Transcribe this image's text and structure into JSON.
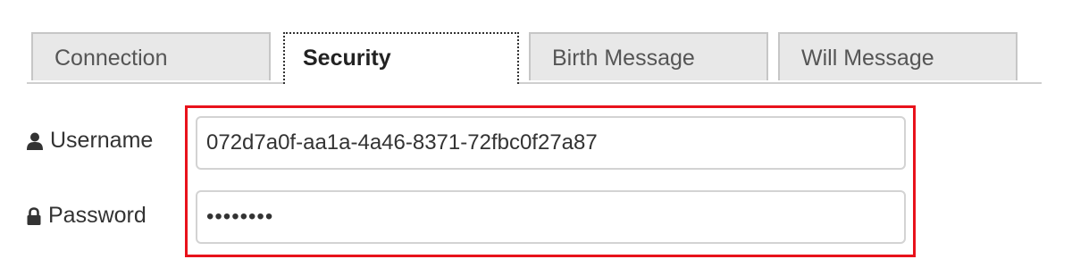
{
  "tabs": [
    {
      "label": "Connection",
      "active": false
    },
    {
      "label": "Security",
      "active": true
    },
    {
      "label": "Birth Message",
      "active": false
    },
    {
      "label": "Will Message",
      "active": false
    }
  ],
  "form": {
    "username": {
      "label": "Username",
      "icon": "user-icon",
      "value": "072d7a0f-aa1a-4a46-8371-72fbc0f27a87"
    },
    "password": {
      "label": "Password",
      "icon": "lock-icon",
      "value": "••••••••"
    }
  },
  "colors": {
    "highlight_border": "#e8121b",
    "active_tab_bg": "#ffffff",
    "inactive_tab_bg": "#e8e8e8"
  }
}
